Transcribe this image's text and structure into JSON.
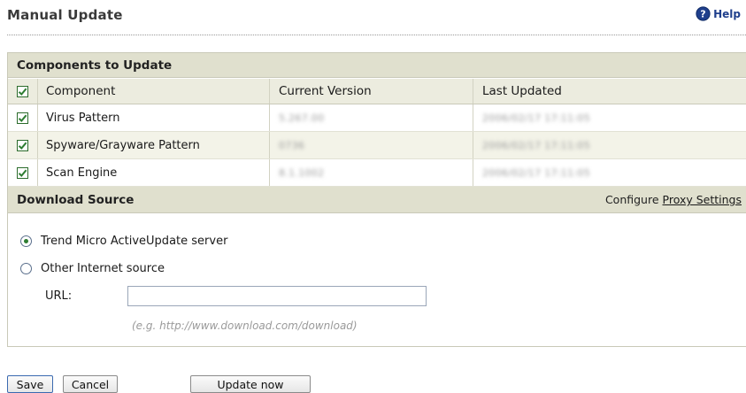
{
  "page": {
    "title": "Manual Update",
    "help_label": "Help"
  },
  "components": {
    "section_title": "Components to Update",
    "columns": {
      "component": "Component",
      "current_version": "Current Version",
      "last_updated": "Last Updated"
    },
    "select_all_checked": true,
    "rows": [
      {
        "name": "Virus Pattern",
        "version": "5.267.00",
        "last_updated": "2006/02/17 17:11:05",
        "checked": true
      },
      {
        "name": "Spyware/Grayware Pattern",
        "version": "0736",
        "last_updated": "2006/02/17 17:11:05",
        "checked": true
      },
      {
        "name": "Scan Engine",
        "version": "8.1.1002",
        "last_updated": "2006/02/17 17:11:05",
        "checked": true
      }
    ]
  },
  "download_source": {
    "section_title": "Download Source",
    "configure_label": "Configure",
    "proxy_link": "Proxy Settings",
    "options": [
      {
        "label": "Trend Micro ActiveUpdate server",
        "selected": true
      },
      {
        "label": "Other Internet source",
        "selected": false
      }
    ],
    "url_label": "URL:",
    "url_value": "",
    "url_hint": "(e.g. http://www.download.com/download)"
  },
  "buttons": {
    "save": "Save",
    "cancel": "Cancel",
    "update_now": "Update now"
  },
  "colors": {
    "section_header_bg": "#e0e0ce",
    "alt_row_bg": "#f3f3e8",
    "check_green": "#2e7d32",
    "help_blue": "#1f3f8c"
  },
  "icons": {
    "help": "help-question-icon",
    "checkbox": "checkmark-icon",
    "radio": "radio-dot-icon"
  }
}
